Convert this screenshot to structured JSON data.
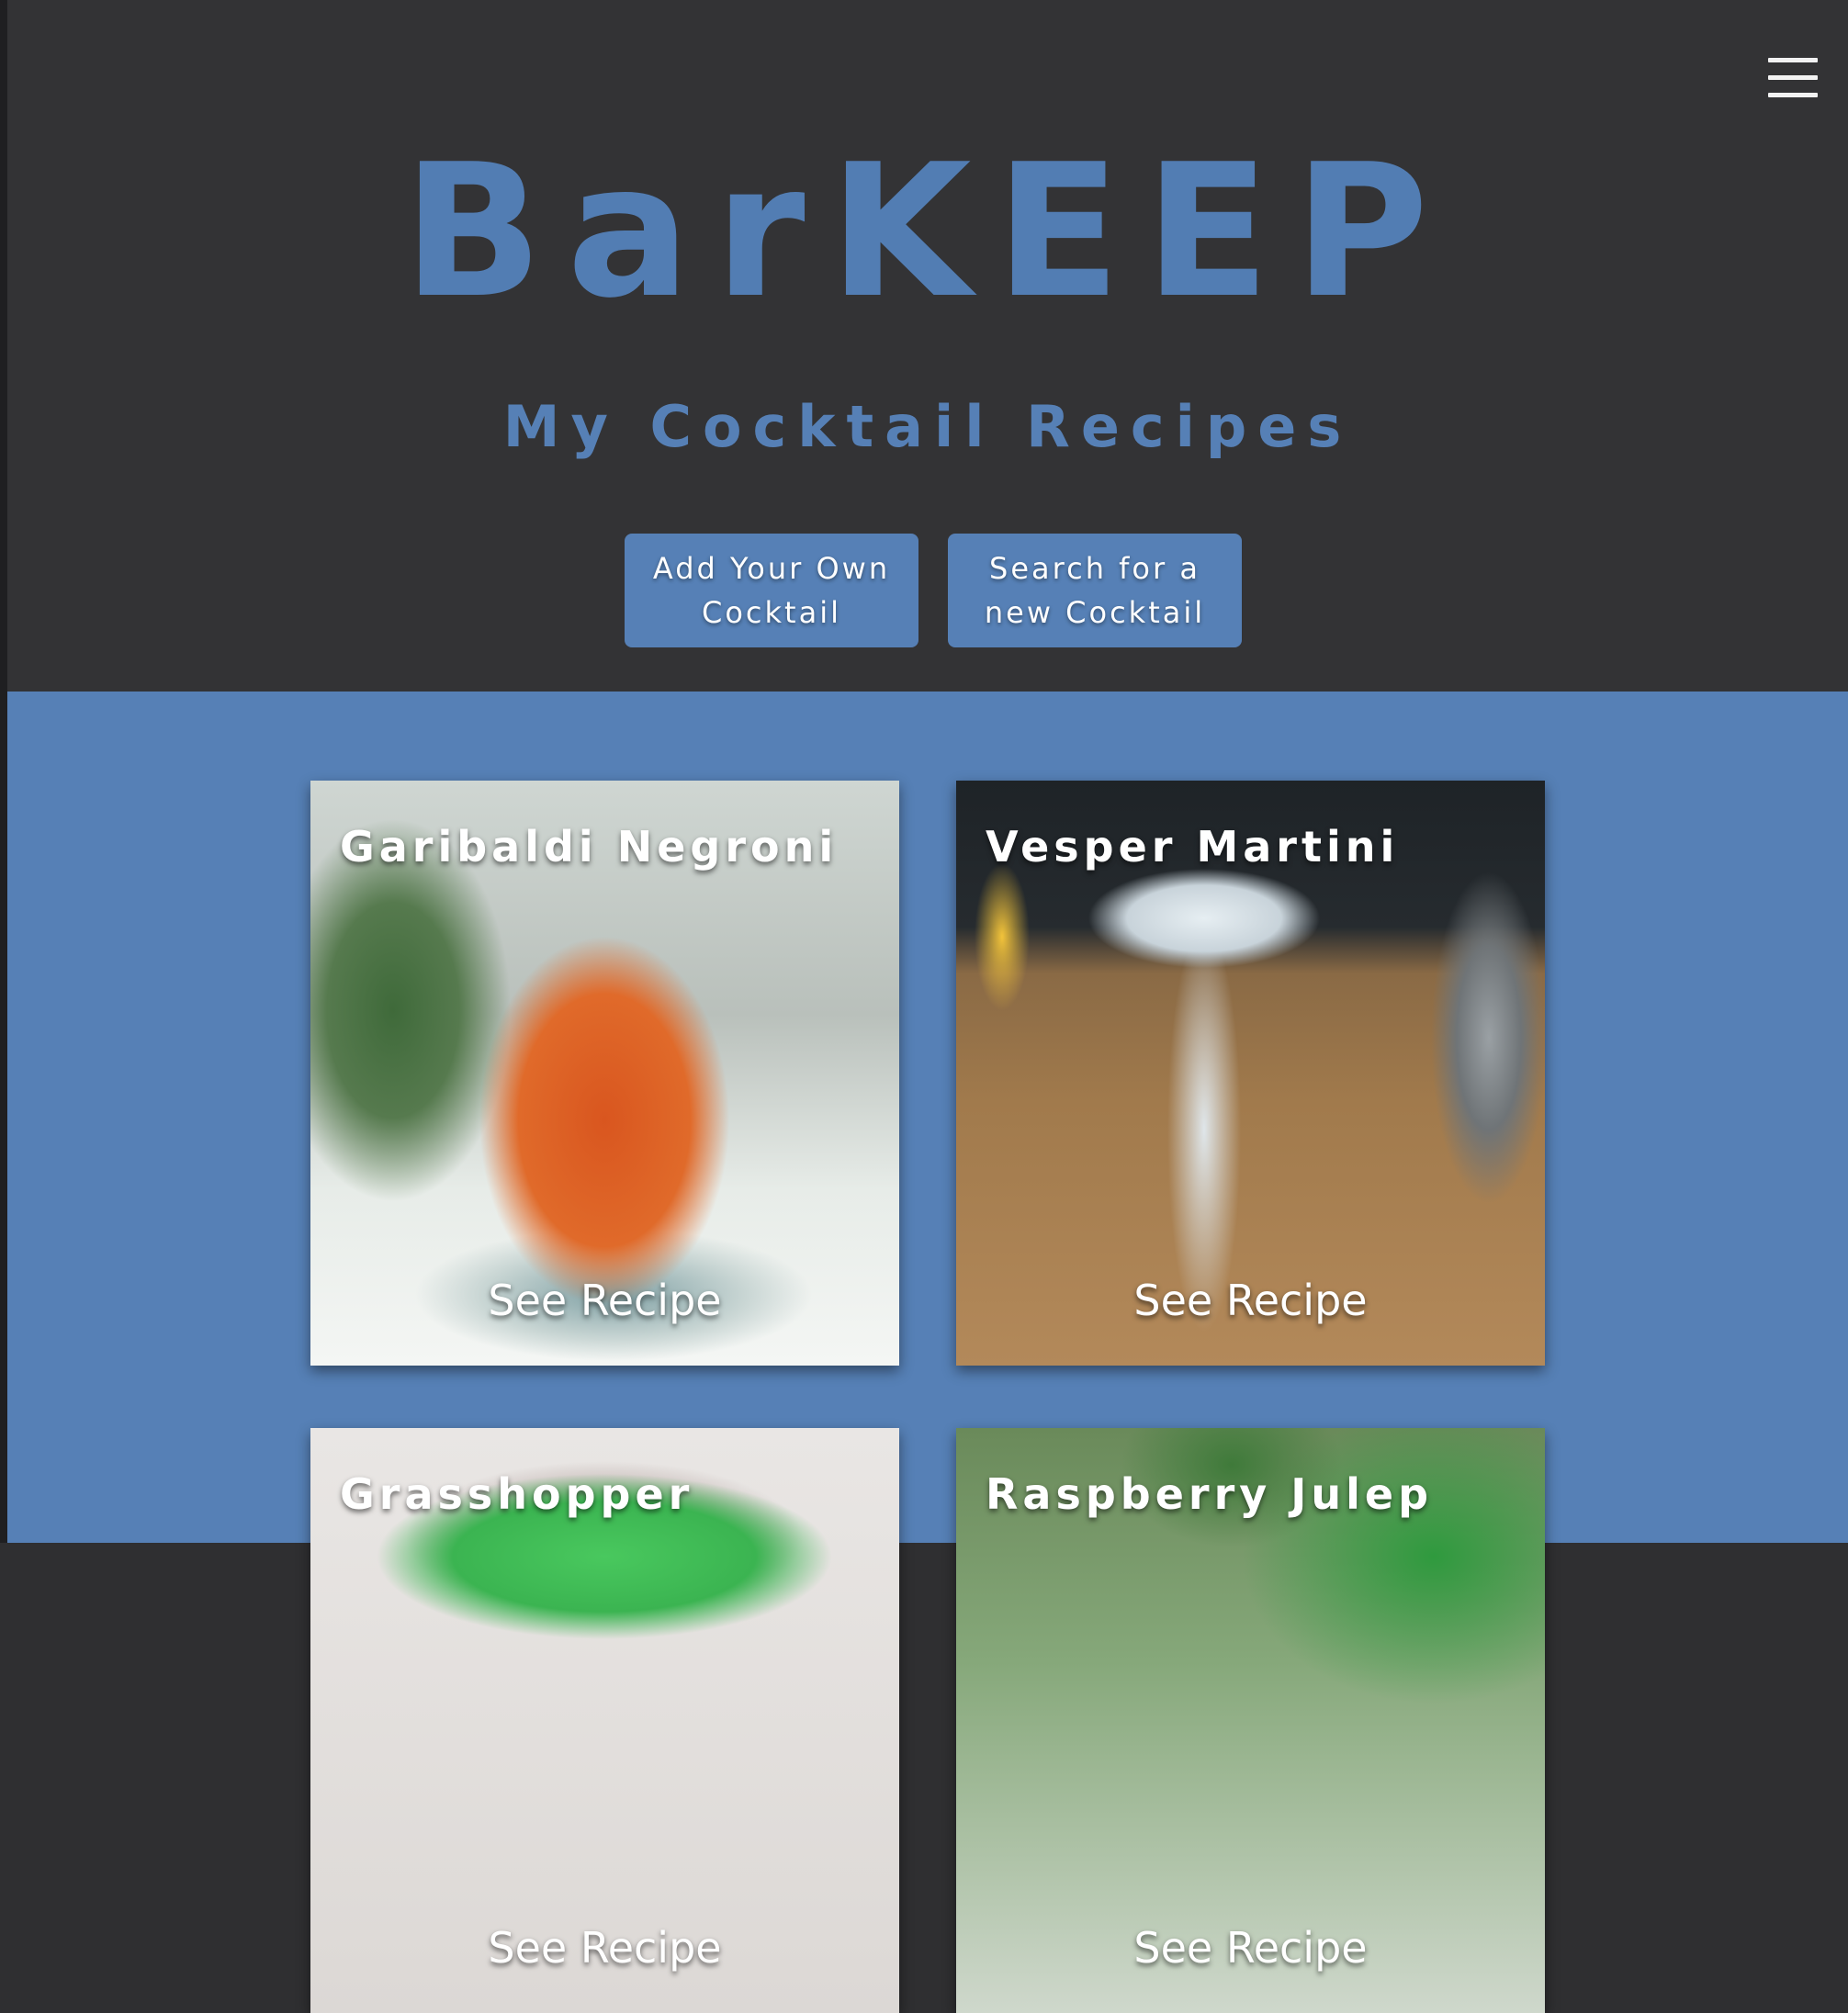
{
  "app": {
    "brand": "BarKEEP",
    "subtitle": "My Cocktail Recipes"
  },
  "nav": {
    "menu_icon": "hamburger-menu-icon"
  },
  "actions": {
    "add_label": "Add Your Own Cocktail",
    "search_label": "Search for a new Cocktail"
  },
  "colors": {
    "accent": "#5680b6",
    "header_bg": "#333335",
    "text_on_accent": "#ffffff"
  },
  "cocktails": [
    {
      "name": "Garibaldi Negroni",
      "link_label": "See Recipe"
    },
    {
      "name": "Vesper Martini",
      "link_label": "See Recipe"
    },
    {
      "name": "Grasshopper",
      "link_label": "See Recipe"
    },
    {
      "name": "Raspberry Julep",
      "link_label": "See Recipe"
    }
  ]
}
